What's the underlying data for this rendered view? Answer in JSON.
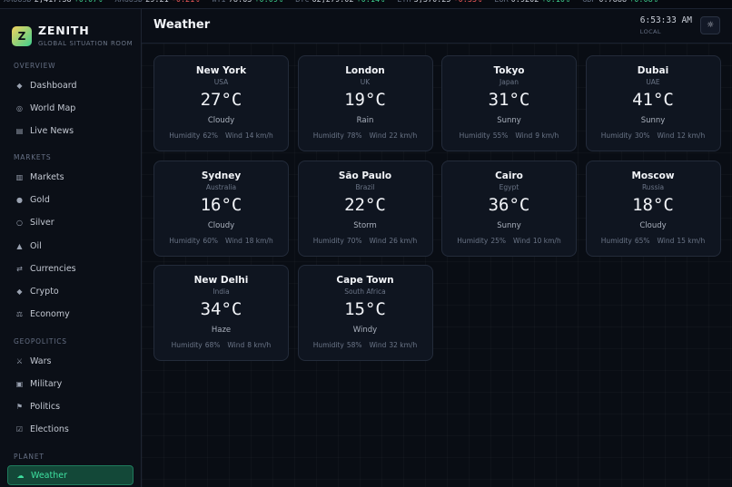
{
  "ticker": [
    {
      "symbol": "XAUUSD",
      "price": "2,417.38",
      "change": "+0.07%",
      "dir": "up"
    },
    {
      "symbol": "XAGUSD",
      "price": "29.21",
      "change": "-0.21%",
      "dir": "down"
    },
    {
      "symbol": "WTI",
      "price": "78.63",
      "change": "+0.09%",
      "dir": "up"
    },
    {
      "symbol": "BTC",
      "price": "62,279.02",
      "change": "+0.14%",
      "dir": "up"
    },
    {
      "symbol": "ETH",
      "price": "3,370.25",
      "change": "-0.35%",
      "dir": "down"
    },
    {
      "symbol": "EUR",
      "price": "0.9202",
      "change": "+0.10%",
      "dir": "up"
    },
    {
      "symbol": "GBP",
      "price": "0.7888",
      "change": "+0.08%",
      "dir": "up"
    }
  ],
  "brand": {
    "name": "ZENITH",
    "subtitle": "GLOBAL SITUATION ROOM",
    "logo_letter": "Z"
  },
  "sidebar": {
    "sections": [
      {
        "label": "OVERVIEW",
        "items": [
          {
            "label": "Dashboard",
            "icon": "◆",
            "icon_name": "diamond-icon"
          },
          {
            "label": "World Map",
            "icon": "◎",
            "icon_name": "globe-icon"
          },
          {
            "label": "Live News",
            "icon": "▤",
            "icon_name": "newspaper-icon"
          }
        ]
      },
      {
        "label": "MARKETS",
        "items": [
          {
            "label": "Markets",
            "icon": "▥",
            "icon_name": "chart-icon"
          },
          {
            "label": "Gold",
            "icon": "●",
            "icon_name": "coin-icon"
          },
          {
            "label": "Silver",
            "icon": "○",
            "icon_name": "circle-icon"
          },
          {
            "label": "Oil",
            "icon": "▲",
            "icon_name": "oil-icon"
          },
          {
            "label": "Currencies",
            "icon": "⇄",
            "icon_name": "exchange-icon"
          },
          {
            "label": "Crypto",
            "icon": "◆",
            "icon_name": "crypto-icon"
          },
          {
            "label": "Economy",
            "icon": "⚖",
            "icon_name": "scales-icon"
          }
        ]
      },
      {
        "label": "GEOPOLITICS",
        "items": [
          {
            "label": "Wars",
            "icon": "⚔",
            "icon_name": "swords-icon"
          },
          {
            "label": "Military",
            "icon": "▣",
            "icon_name": "shield-icon"
          },
          {
            "label": "Politics",
            "icon": "⚑",
            "icon_name": "flag-icon"
          },
          {
            "label": "Elections",
            "icon": "☑",
            "icon_name": "ballot-icon"
          }
        ]
      },
      {
        "label": "PLANET",
        "items": [
          {
            "label": "Weather",
            "icon": "☁",
            "icon_name": "cloud-icon",
            "active": true
          }
        ]
      }
    ]
  },
  "header": {
    "title": "Weather",
    "clock_time": "6:53:33 AM",
    "clock_zone": "LOCAL",
    "theme_icon": "☼"
  },
  "labels": {
    "humidity": "Humidity",
    "wind": "Wind"
  },
  "weather": [
    {
      "city": "New York",
      "country": "USA",
      "temp": "27°C",
      "condition": "Cloudy",
      "humidity": "62%",
      "wind": "14 km/h"
    },
    {
      "city": "London",
      "country": "UK",
      "temp": "19°C",
      "condition": "Rain",
      "humidity": "78%",
      "wind": "22 km/h"
    },
    {
      "city": "Tokyo",
      "country": "Japan",
      "temp": "31°C",
      "condition": "Sunny",
      "humidity": "55%",
      "wind": "9 km/h"
    },
    {
      "city": "Dubai",
      "country": "UAE",
      "temp": "41°C",
      "condition": "Sunny",
      "humidity": "30%",
      "wind": "12 km/h"
    },
    {
      "city": "Sydney",
      "country": "Australia",
      "temp": "16°C",
      "condition": "Cloudy",
      "humidity": "60%",
      "wind": "18 km/h"
    },
    {
      "city": "São Paulo",
      "country": "Brazil",
      "temp": "22°C",
      "condition": "Storm",
      "humidity": "70%",
      "wind": "26 km/h"
    },
    {
      "city": "Cairo",
      "country": "Egypt",
      "temp": "36°C",
      "condition": "Sunny",
      "humidity": "25%",
      "wind": "10 km/h"
    },
    {
      "city": "Moscow",
      "country": "Russia",
      "temp": "18°C",
      "condition": "Cloudy",
      "humidity": "65%",
      "wind": "15 km/h"
    },
    {
      "city": "New Delhi",
      "country": "India",
      "temp": "34°C",
      "condition": "Haze",
      "humidity": "68%",
      "wind": "8 km/h"
    },
    {
      "city": "Cape Town",
      "country": "South Africa",
      "temp": "15°C",
      "condition": "Windy",
      "humidity": "58%",
      "wind": "32 km/h"
    }
  ]
}
